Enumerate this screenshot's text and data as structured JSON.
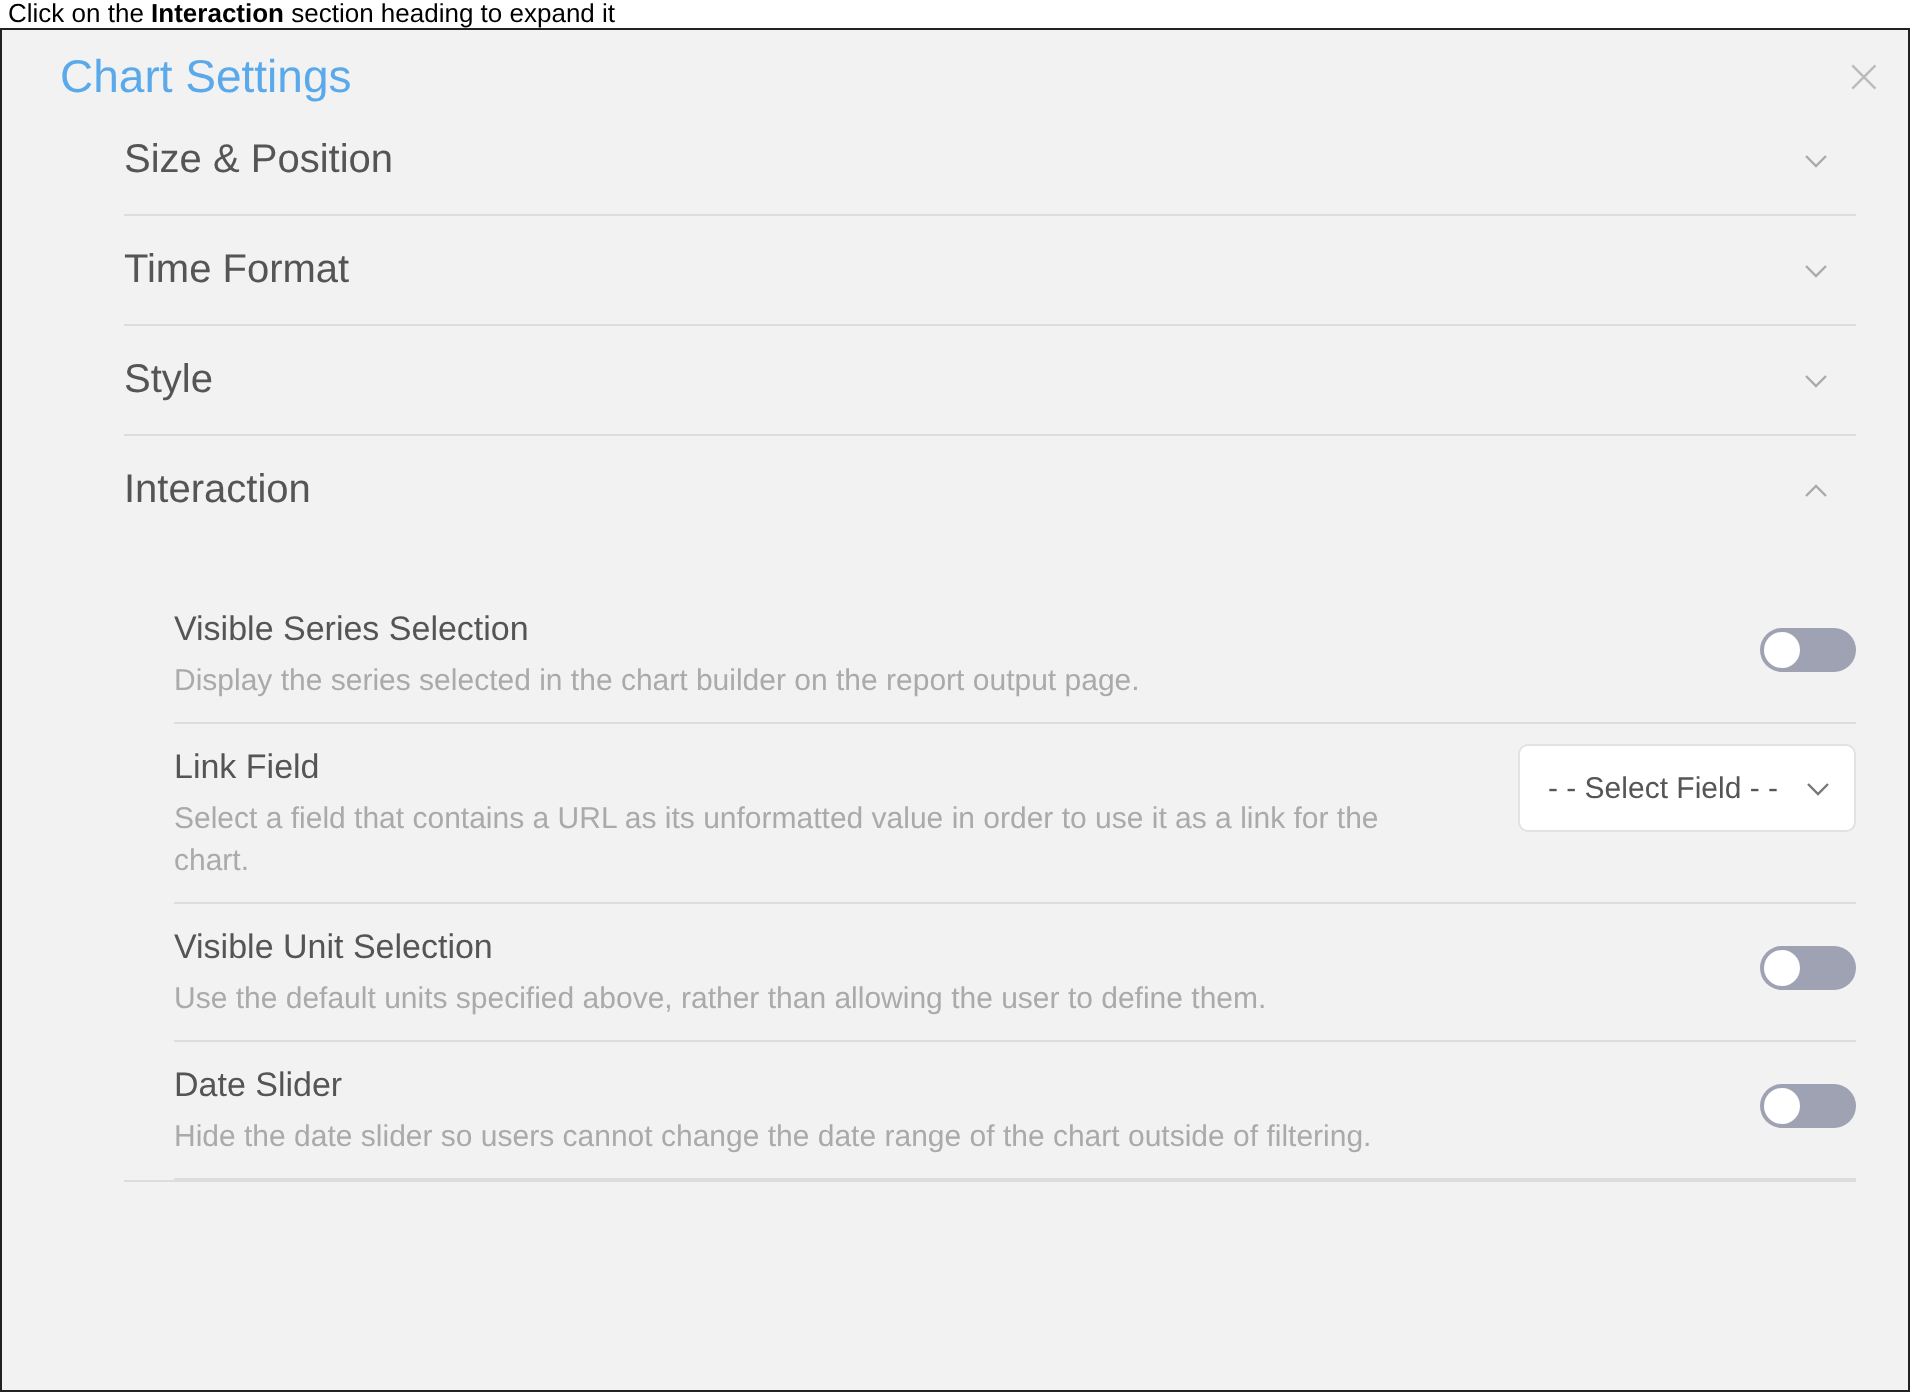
{
  "caption": "Click on the **Interaction** section heading to expand it",
  "dialog": {
    "title": "Chart Settings",
    "close": "×"
  },
  "sections": [
    {
      "title": "Size & Position",
      "expanded": false
    },
    {
      "title": "Time Format",
      "expanded": false
    },
    {
      "title": "Style",
      "expanded": false
    },
    {
      "title": "Interaction",
      "expanded": true,
      "items": [
        {
          "kind": "toggle",
          "label": "Visible Series Selection",
          "description": "Display the series selected in the chart builder on the report output page.",
          "on": false
        },
        {
          "kind": "select",
          "label": "Link Field",
          "description": "Select a field that contains a URL as its unformatted value in order to use it as a link for the chart.",
          "value": "- - Select Field - -"
        },
        {
          "kind": "toggle",
          "label": "Visible Unit Selection",
          "description": "Use the default units specified above, rather than allowing the user to define them.",
          "on": false
        },
        {
          "kind": "toggle",
          "label": "Date Slider",
          "description": "Hide the date slider so users cannot change the date range of the chart outside of filtering.",
          "on": false
        }
      ]
    }
  ]
}
